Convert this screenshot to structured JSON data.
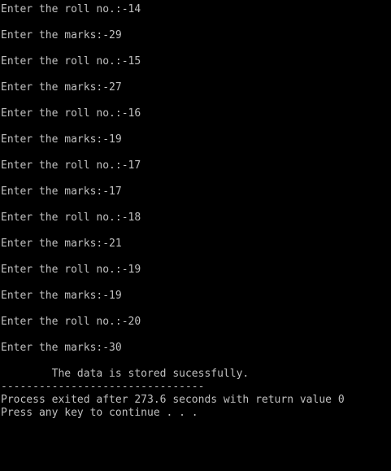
{
  "console": {
    "lines": [
      "Enter the roll no.:-14",
      "Enter the marks:-29",
      "Enter the roll no.:-15",
      "Enter the marks:-27",
      "Enter the roll no.:-16",
      "Enter the marks:-19",
      "Enter the roll no.:-17",
      "Enter the marks:-17",
      "Enter the roll no.:-18",
      "Enter the marks:-21",
      "Enter the roll no.:-19",
      "Enter the marks:-19",
      "Enter the roll no.:-20",
      "Enter the marks:-30",
      "        The data is stored sucessfully.",
      "--------------------------------",
      "Process exited after 273.6 seconds with return value 0",
      "Press any key to continue . . ."
    ]
  }
}
